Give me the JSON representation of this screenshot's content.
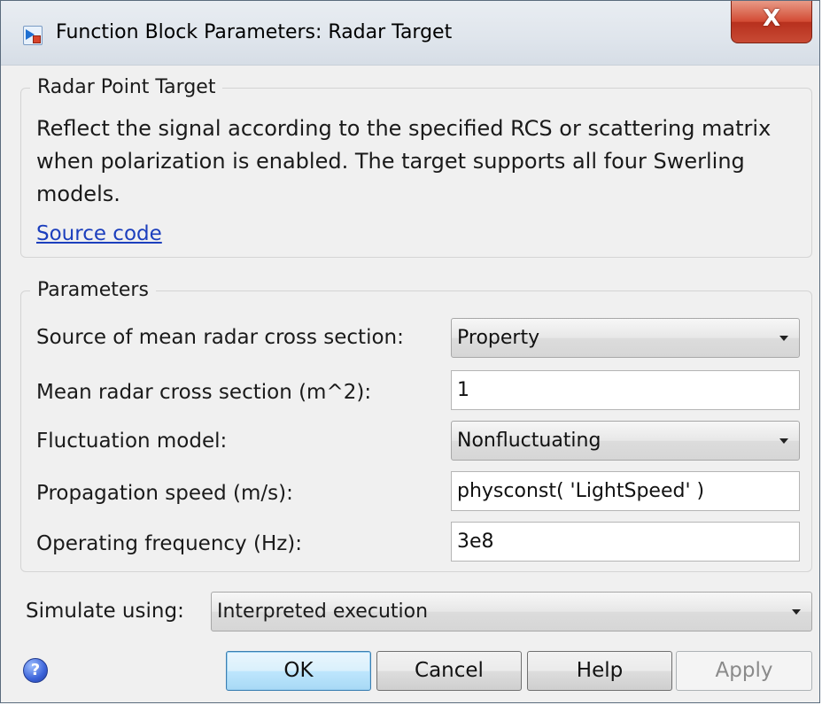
{
  "window": {
    "title": "Function Block Parameters: Radar Target",
    "close_label": "X"
  },
  "description_group": {
    "legend": "Radar Point Target",
    "text": "Reflect the signal according to the specified RCS or scattering matrix when polarization is enabled. The target supports all four Swerling models.",
    "link_label": "Source code"
  },
  "parameters_group": {
    "legend": "Parameters",
    "rows": [
      {
        "label": "Source of mean radar cross section:",
        "value": "Property",
        "kind": "dropdown"
      },
      {
        "label": "Mean radar cross section (m^2):",
        "value": "1",
        "kind": "edit"
      },
      {
        "label": "Fluctuation model:",
        "value": "Nonfluctuating",
        "kind": "dropdown"
      },
      {
        "label": "Propagation speed (m/s):",
        "value": "physconst( 'LightSpeed' )",
        "kind": "edit"
      },
      {
        "label": "Operating frequency (Hz):",
        "value": "3e8",
        "kind": "edit"
      }
    ]
  },
  "simulate": {
    "label": "Simulate using:",
    "value": "Interpreted execution"
  },
  "buttons": {
    "help_icon_glyph": "?",
    "ok": "OK",
    "cancel": "Cancel",
    "help": "Help",
    "apply": "Apply"
  }
}
